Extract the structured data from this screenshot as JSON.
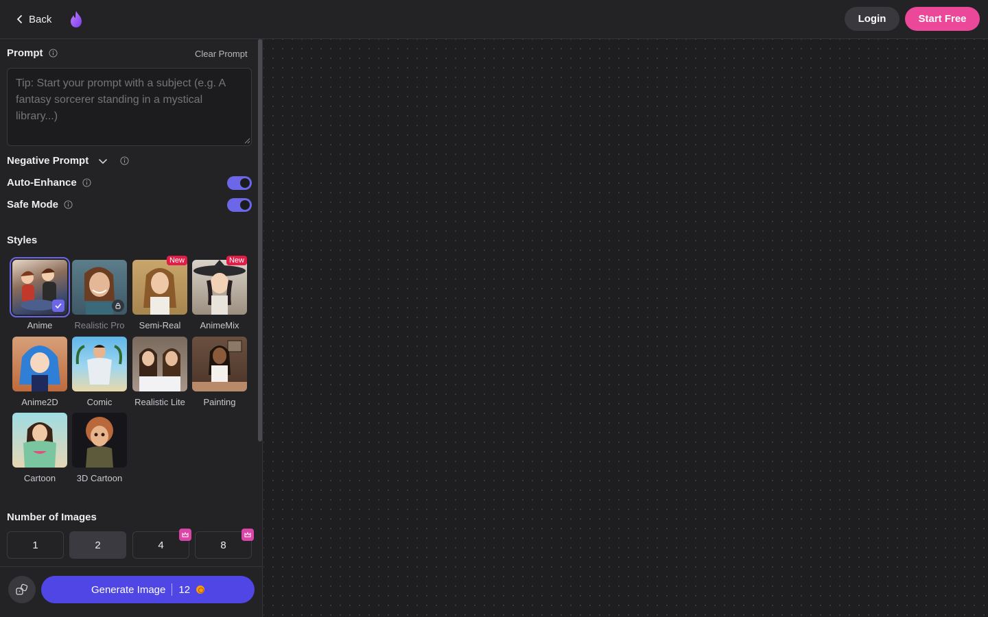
{
  "header": {
    "back_label": "Back",
    "login_label": "Login",
    "start_label": "Start Free"
  },
  "prompt": {
    "label": "Prompt",
    "clear_label": "Clear Prompt",
    "placeholder": "Tip: Start your prompt with a subject (e.g. A fantasy sorcerer standing in a mystical library...)"
  },
  "settings": {
    "negative_prompt_label": "Negative Prompt",
    "auto_enhance_label": "Auto-Enhance",
    "auto_enhance_on": true,
    "safe_mode_label": "Safe Mode",
    "safe_mode_on": true
  },
  "styles": {
    "title": "Styles",
    "new_badge": "New",
    "items": [
      {
        "name": "Anime",
        "selected": true,
        "locked": false,
        "is_new": false
      },
      {
        "name": "Realistic Pro",
        "selected": false,
        "locked": true,
        "is_new": false
      },
      {
        "name": "Semi-Real",
        "selected": false,
        "locked": false,
        "is_new": true
      },
      {
        "name": "AnimeMix",
        "selected": false,
        "locked": false,
        "is_new": true
      },
      {
        "name": "Anime2D",
        "selected": false,
        "locked": false,
        "is_new": false
      },
      {
        "name": "Comic",
        "selected": false,
        "locked": false,
        "is_new": false
      },
      {
        "name": "Realistic Lite",
        "selected": false,
        "locked": false,
        "is_new": false
      },
      {
        "name": "Painting",
        "selected": false,
        "locked": false,
        "is_new": false
      },
      {
        "name": "Cartoon",
        "selected": false,
        "locked": false,
        "is_new": false
      },
      {
        "name": "3D Cartoon",
        "selected": false,
        "locked": false,
        "is_new": false
      }
    ]
  },
  "images": {
    "title": "Number of Images",
    "options": [
      {
        "label": "1",
        "premium": false
      },
      {
        "label": "2",
        "premium": false,
        "active": true
      },
      {
        "label": "4",
        "premium": true
      },
      {
        "label": "8",
        "premium": true
      }
    ]
  },
  "generate": {
    "label": "Generate Image",
    "cost": "12"
  },
  "colors": {
    "accent": "#6b67e8",
    "generate": "#4f46e5",
    "brand_pink": "#ec4899",
    "new_badge": "#e11d48"
  }
}
